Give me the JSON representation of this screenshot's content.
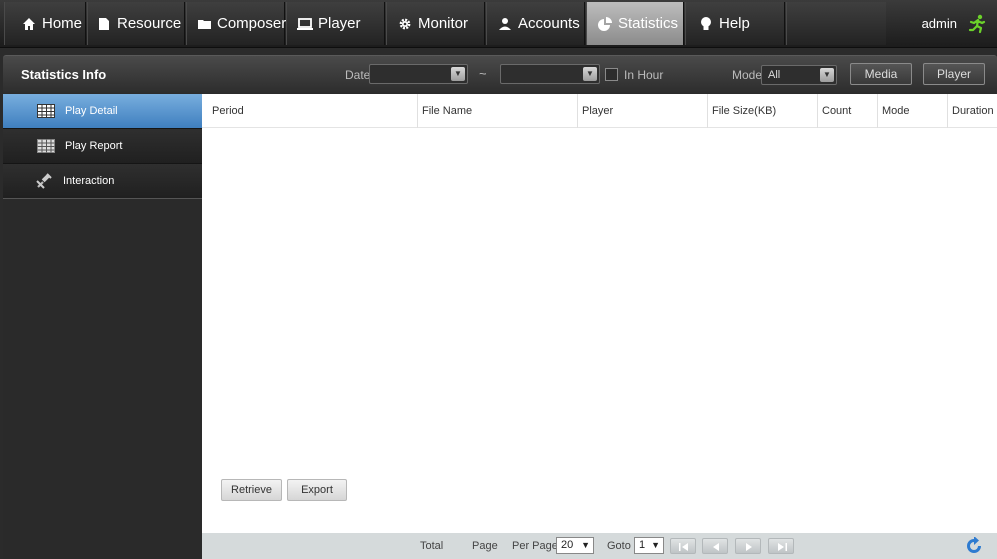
{
  "nav": {
    "items": [
      {
        "label": "Home",
        "icon": "home-icon"
      },
      {
        "label": "Resource",
        "icon": "document-icon"
      },
      {
        "label": "Composer",
        "icon": "folder-icon"
      },
      {
        "label": "Player",
        "icon": "monitor-icon"
      },
      {
        "label": "Monitor",
        "icon": "gear-icon"
      },
      {
        "label": "Accounts",
        "icon": "user-icon"
      },
      {
        "label": "Statistics",
        "icon": "pie-chart-icon"
      },
      {
        "label": "Help",
        "icon": "lightbulb-icon"
      }
    ],
    "active": "Statistics",
    "user": "admin"
  },
  "subbar": {
    "title": "Statistics Info",
    "date_label": "Date",
    "date_from": "",
    "tilde": "~",
    "date_to": "",
    "in_hour_label": "In Hour",
    "mode_label": "Mode",
    "mode_value": "All",
    "media_button": "Media",
    "player_button": "Player"
  },
  "sidebar": {
    "items": [
      {
        "label": "Play Detail",
        "icon": "grid-table-icon",
        "active": true
      },
      {
        "label": "Play Report",
        "icon": "grid-table-icon",
        "active": false
      },
      {
        "label": "Interaction",
        "icon": "satellite-icon",
        "active": false
      }
    ]
  },
  "table": {
    "columns": [
      "Period",
      "File Name",
      "Player",
      "File Size(KB)",
      "Count",
      "Mode",
      "Duration"
    ],
    "rows": []
  },
  "actions": {
    "retrieve": "Retrieve",
    "export": "Export"
  },
  "pager": {
    "total_label": "Total",
    "page_label": "Page",
    "per_page_label": "Per Page",
    "per_page_value": "20",
    "goto_label": "Goto",
    "goto_value": "1"
  },
  "colors": {
    "active_nav": "#a6a6a6",
    "active_side": "#5c97d0",
    "runner": "#6bd22a",
    "refresh": "#2e7bd0"
  }
}
